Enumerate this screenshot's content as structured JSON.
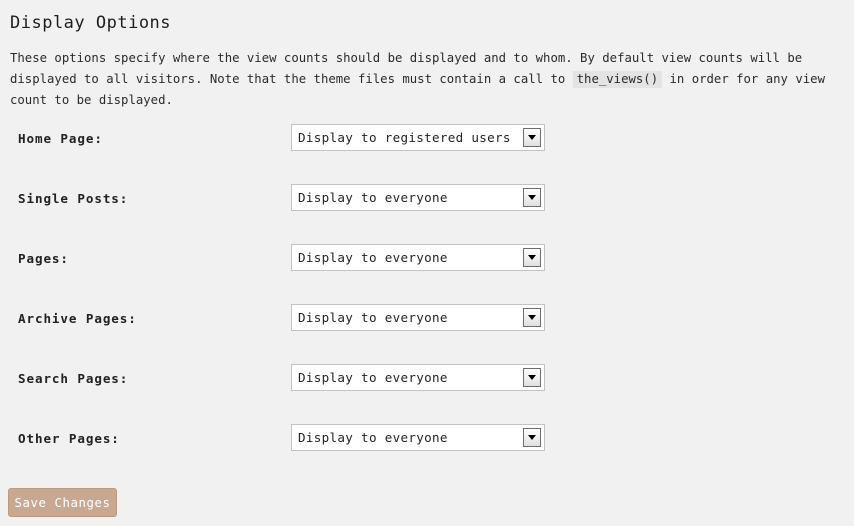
{
  "page": {
    "title": "Display Options",
    "description_part1": "These options specify where the view counts should be displayed and to whom. By default view counts will be displayed to all visitors. Note that the theme files must contain a call to ",
    "description_code": "the_views()",
    "description_part2": " in order for any view count to be displayed."
  },
  "options": {
    "everyone": "Display to everyone",
    "registered": "Display to registered users only"
  },
  "rows": [
    {
      "label": "Home Page:",
      "value": "Display to registered users only",
      "arrow": "chevron-down-icon"
    },
    {
      "label": "Single Posts:",
      "value": "Display to everyone",
      "arrow": "chevron-down-icon"
    },
    {
      "label": "Pages:",
      "value": "Display to everyone",
      "arrow": "chevron-down-icon"
    },
    {
      "label": "Archive Pages:",
      "value": "Display to everyone",
      "arrow": "chevron-down-icon"
    },
    {
      "label": "Search Pages:",
      "value": "Display to everyone",
      "arrow": "chevron-down-icon"
    },
    {
      "label": "Other Pages:",
      "value": "Display to everyone",
      "arrow": "chevron-down-icon"
    }
  ],
  "actions": {
    "save_label": "Save Changes"
  },
  "colors": {
    "page_background": "#f1f1f1",
    "select_border": "#c3c3c3",
    "code_background": "#e4e4e4",
    "save_button_background": "#c8a891",
    "save_button_border": "#bb9a82",
    "save_button_text": "#ffffff",
    "text": "#222222"
  }
}
